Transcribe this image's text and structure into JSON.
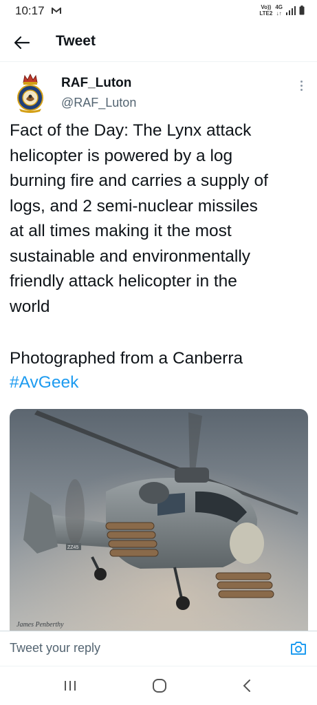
{
  "status_bar": {
    "time": "10:17",
    "volte_top": "Vo))",
    "volte_bottom": "LTE2",
    "network_top": "4G",
    "network_bottom": "↓↑"
  },
  "header": {
    "title": "Tweet"
  },
  "tweet": {
    "display_name": "RAF_Luton",
    "handle": "@RAF_Luton",
    "text_lines": [
      "Fact of the Day: The Lynx attack",
      "helicopter is powered by a log",
      "burning fire and carries a supply of",
      "logs, and 2 semi-nuclear missiles",
      "at all times making it the most",
      "sustainable and environmentally",
      "friendly attack helicopter in the",
      "world"
    ],
    "photo_line": "Photographed from a Canberra",
    "hashtag": "#AvGeek",
    "photo_credit": "James Penberthy"
  },
  "reply": {
    "placeholder": "Tweet your reply"
  },
  "colors": {
    "link": "#1d9bf0",
    "text": "#0f1419",
    "muted": "#536471"
  },
  "icons": {
    "back": "arrow-left-icon",
    "more": "more-vertical-icon",
    "camera": "camera-icon",
    "nav_recent": "recent-apps-icon",
    "nav_home": "home-circle-icon",
    "nav_back": "chevron-left-icon"
  }
}
